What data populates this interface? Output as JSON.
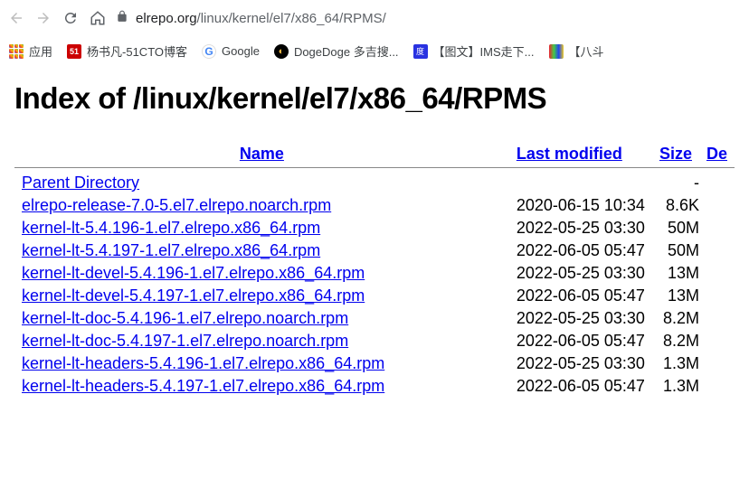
{
  "browser": {
    "url_domain": "elrepo.org",
    "url_path": "/linux/kernel/el7/x86_64/RPMS/"
  },
  "bookmarks": {
    "apps": "应用",
    "items": [
      {
        "label": "杨书凡-51CTO博客",
        "fav": "51"
      },
      {
        "label": "Google",
        "fav": "g"
      },
      {
        "label": "DogeDoge 多吉搜...",
        "fav": "doge"
      },
      {
        "label": "【图文】IMS走下...",
        "fav": "baidu"
      },
      {
        "label": "【八斗",
        "fav": "colors"
      }
    ]
  },
  "page": {
    "title": "Index of /linux/kernel/el7/x86_64/RPMS",
    "headers": {
      "name": "Name",
      "modified": "Last modified",
      "size": "Size",
      "desc": "De"
    },
    "parent_label": "Parent Directory",
    "files": [
      {
        "name": "elrepo-release-7.0-5.el7.elrepo.noarch.rpm",
        "modified": "2020-06-15 10:34",
        "size": "8.6K"
      },
      {
        "name": "kernel-lt-5.4.196-1.el7.elrepo.x86_64.rpm",
        "modified": "2022-05-25 03:30",
        "size": "50M"
      },
      {
        "name": "kernel-lt-5.4.197-1.el7.elrepo.x86_64.rpm",
        "modified": "2022-06-05 05:47",
        "size": "50M"
      },
      {
        "name": "kernel-lt-devel-5.4.196-1.el7.elrepo.x86_64.rpm",
        "modified": "2022-05-25 03:30",
        "size": "13M"
      },
      {
        "name": "kernel-lt-devel-5.4.197-1.el7.elrepo.x86_64.rpm",
        "modified": "2022-06-05 05:47",
        "size": "13M"
      },
      {
        "name": "kernel-lt-doc-5.4.196-1.el7.elrepo.noarch.rpm",
        "modified": "2022-05-25 03:30",
        "size": "8.2M"
      },
      {
        "name": "kernel-lt-doc-5.4.197-1.el7.elrepo.noarch.rpm",
        "modified": "2022-06-05 05:47",
        "size": "8.2M"
      },
      {
        "name": "kernel-lt-headers-5.4.196-1.el7.elrepo.x86_64.rpm",
        "modified": "2022-05-25 03:30",
        "size": "1.3M"
      },
      {
        "name": "kernel-lt-headers-5.4.197-1.el7.elrepo.x86_64.rpm",
        "modified": "2022-06-05 05:47",
        "size": "1.3M"
      }
    ]
  }
}
